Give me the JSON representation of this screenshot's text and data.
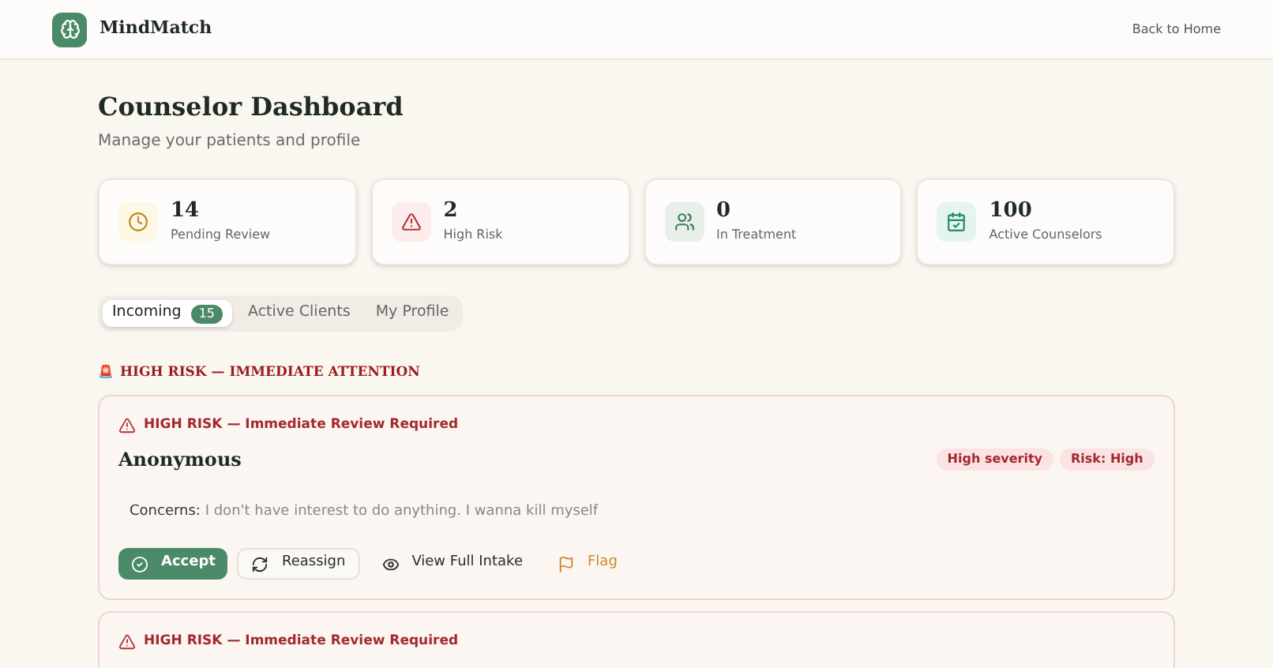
{
  "header": {
    "brand": "MindMatch",
    "link": "Back to Home"
  },
  "page": {
    "title": "Counselor Dashboard",
    "subtitle": "Manage your patients and profile"
  },
  "stats": [
    {
      "kind": "clock",
      "value": "14",
      "label": "Pending Review"
    },
    {
      "kind": "alert",
      "value": "2",
      "label": "High Risk"
    },
    {
      "kind": "users",
      "value": "0",
      "label": "In Treatment"
    },
    {
      "kind": "calendar",
      "value": "100",
      "label": "Active Counselors"
    }
  ],
  "tabs": [
    {
      "label": "Incoming",
      "count": "15",
      "selected": true
    },
    {
      "label": "Active Clients",
      "selected": false
    },
    {
      "label": "My Profile",
      "selected": false
    }
  ],
  "section_heading": {
    "icon": "🚨",
    "text": "HIGH RISK — IMMEDIATE ATTENTION"
  },
  "cards": [
    {
      "alert": "HIGH RISK — Immediate Review Required",
      "name": "Anonymous",
      "tags": [
        {
          "text": "High severity",
          "color": "#fbe3e4"
        },
        {
          "text": "Risk: High",
          "color": "#fbe3e4"
        }
      ],
      "concerns_label": "Concerns:",
      "concerns": "I don't have interest to do anything. I wanna kill myself",
      "actions": [
        {
          "kind": "primary",
          "label": "Accept"
        },
        {
          "kind": "outline",
          "label": "Reassign"
        },
        {
          "kind": "ghost",
          "label": "View Full Intake"
        },
        {
          "kind": "flag",
          "label": "Flag"
        }
      ]
    },
    {
      "alert": "HIGH RISK — Immediate Review Required"
    }
  ]
}
